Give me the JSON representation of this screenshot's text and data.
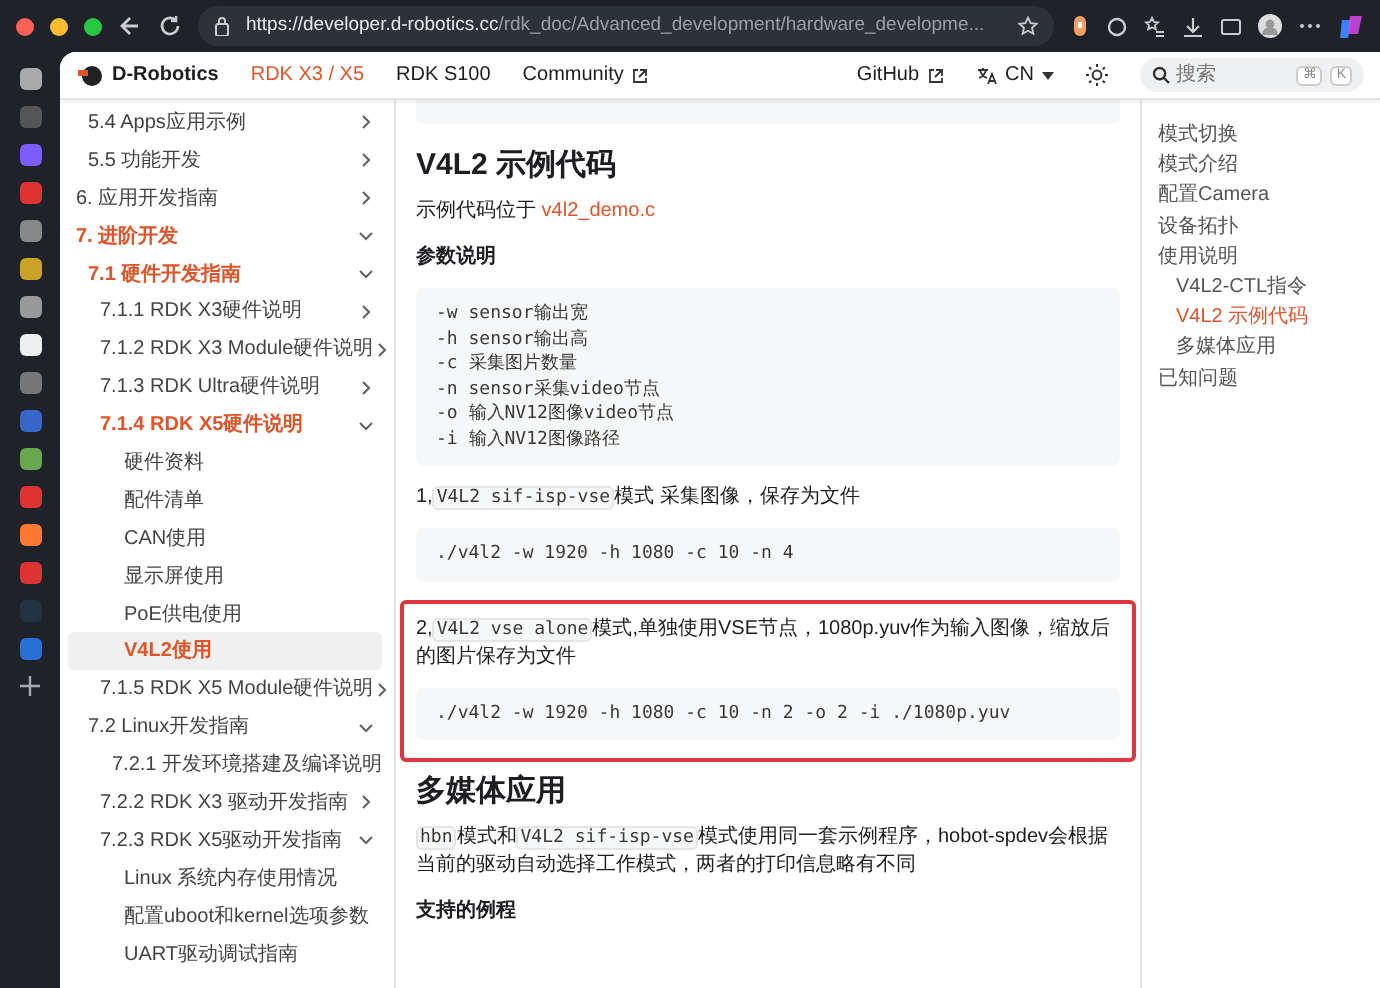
{
  "browser": {
    "url_host": "https://developer.d-robotics.cc",
    "url_path": "/rdk_doc/Advanced_development/hardware_developme..."
  },
  "navbar": {
    "brand": "D-Robotics",
    "links": [
      {
        "label": "RDK X3 / X5",
        "selected": true,
        "external": false
      },
      {
        "label": "RDK S100",
        "selected": false,
        "external": false
      },
      {
        "label": "Community",
        "selected": false,
        "external": true
      }
    ],
    "github": "GitHub",
    "language": "CN",
    "search": {
      "placeholder": "搜索",
      "keys": [
        "⌘",
        "K"
      ]
    }
  },
  "sidebar": {
    "items": [
      {
        "children": [
          {
            "label": "5.4 Apps应用示例",
            "kind": "category",
            "expanded": false,
            "active": false,
            "selected": false
          },
          {
            "label": "5.5 功能开发",
            "kind": "category",
            "expanded": false,
            "active": false,
            "selected": false
          }
        ]
      },
      {
        "label": "6. 应用开发指南",
        "kind": "category",
        "expanded": false,
        "active": false,
        "selected": false
      },
      {
        "label": "7. 进阶开发",
        "kind": "category",
        "expanded": true,
        "active": true,
        "selected": false,
        "children": [
          {
            "label": "7.1 硬件开发指南",
            "kind": "category",
            "expanded": true,
            "active": true,
            "selected": false,
            "children": [
              {
                "label": "7.1.1 RDK X3硬件说明",
                "kind": "category",
                "expanded": false,
                "active": false,
                "selected": false
              },
              {
                "label": "7.1.2 RDK X3 Module硬件说明",
                "kind": "category",
                "expanded": false,
                "active": false,
                "selected": false
              },
              {
                "label": "7.1.3 RDK Ultra硬件说明",
                "kind": "category",
                "expanded": false,
                "active": false,
                "selected": false
              },
              {
                "label": "7.1.4 RDK X5硬件说明",
                "kind": "category",
                "expanded": true,
                "active": true,
                "selected": false,
                "children": [
                  {
                    "label": "硬件资料",
                    "kind": "link",
                    "active": false,
                    "selected": false
                  },
                  {
                    "label": "配件清单",
                    "kind": "link",
                    "active": false,
                    "selected": false
                  },
                  {
                    "label": "CAN使用",
                    "kind": "link",
                    "active": false,
                    "selected": false
                  },
                  {
                    "label": "显示屏使用",
                    "kind": "link",
                    "active": false,
                    "selected": false
                  },
                  {
                    "label": "PoE供电使用",
                    "kind": "link",
                    "active": false,
                    "selected": false
                  },
                  {
                    "label": "V4L2使用",
                    "kind": "link",
                    "active": true,
                    "selected": true
                  }
                ]
              },
              {
                "label": "7.1.5 RDK X5 Module硬件说明",
                "kind": "category",
                "expanded": false,
                "active": false,
                "selected": false
              }
            ]
          },
          {
            "label": "7.2 Linux开发指南",
            "kind": "category",
            "expanded": true,
            "active": false,
            "selected": false,
            "children": [
              {
                "label": "7.2.1 开发环境搭建及编译说明",
                "kind": "link",
                "active": false,
                "selected": false
              },
              {
                "label": "7.2.2 RDK X3 驱动开发指南",
                "kind": "category",
                "expanded": false,
                "active": false,
                "selected": false
              },
              {
                "label": "7.2.3 RDK X5驱动开发指南",
                "kind": "category",
                "expanded": true,
                "active": false,
                "selected": false,
                "children": [
                  {
                    "label": "Linux 系统内存使用情况",
                    "kind": "link",
                    "active": false,
                    "selected": false
                  },
                  {
                    "label": "配置uboot和kernel选项参数",
                    "kind": "link",
                    "active": false,
                    "selected": false
                  },
                  {
                    "label": "UART驱动调试指南",
                    "kind": "link",
                    "active": false,
                    "selected": false
                  }
                ]
              }
            ]
          }
        ]
      }
    ]
  },
  "content": {
    "blocks": [
      {
        "kind": "code_tail"
      },
      {
        "kind": "heading",
        "text": "V4L2 示例代码"
      },
      {
        "kind": "paragraph",
        "parts": [
          {
            "kind": "text",
            "text": "示例代码位于 "
          },
          {
            "kind": "link",
            "text": "v4l2_demo.c"
          }
        ]
      },
      {
        "kind": "label",
        "text": "参数说明"
      },
      {
        "kind": "code",
        "lines": [
          "-w sensor输出宽",
          "-h sensor输出高",
          "-c 采集图片数量",
          "-n sensor采集video节点",
          "-o 输入NV12图像video节点",
          "-i 输入NV12图像路径"
        ]
      },
      {
        "kind": "paragraph",
        "parts": [
          {
            "kind": "text",
            "text": "1,"
          },
          {
            "kind": "code",
            "text": "V4L2 sif-isp-vse"
          },
          {
            "kind": "text",
            "text": "模式 采集图像，保存为文件"
          }
        ]
      },
      {
        "kind": "code",
        "lines": [
          "./v4l2 -w 1920 -h 1080 -c 10 -n 4"
        ]
      },
      {
        "kind": "highlight",
        "blocks": [
          {
            "kind": "paragraph",
            "parts": [
              {
                "kind": "text",
                "text": "2,"
              },
              {
                "kind": "code",
                "text": "V4L2 vse alone"
              },
              {
                "kind": "text",
                "text": "模式,单独使用VSE节点，1080p.yuv作为输入图像，缩放后的图片保存为文件"
              }
            ]
          },
          {
            "kind": "code",
            "lines": [
              "./v4l2 -w 1920 -h 1080 -c 10 -n 2 -o 2 -i ./1080p.yuv"
            ]
          }
        ]
      },
      {
        "kind": "heading",
        "text": "多媒体应用"
      },
      {
        "kind": "paragraph",
        "parts": [
          {
            "kind": "code",
            "text": "hbn"
          },
          {
            "kind": "text",
            "text": "模式和"
          },
          {
            "kind": "code",
            "text": "V4L2 sif-isp-vse"
          },
          {
            "kind": "text",
            "text": "模式使用同一套示例程序，hobot-spdev会根据当前的驱动自动选择工作模式，两者的打印信息略有不同"
          }
        ]
      },
      {
        "kind": "label",
        "text": "支持的例程"
      }
    ]
  },
  "toc": {
    "items": [
      {
        "label": "模式切换",
        "selected": false
      },
      {
        "label": "模式介绍",
        "selected": false
      },
      {
        "label": "配置Camera",
        "selected": false
      },
      {
        "label": "设备拓扑",
        "selected": false
      },
      {
        "label": "使用说明",
        "selected": false,
        "children": [
          {
            "label": "V4L2-CTL指令",
            "selected": false
          },
          {
            "label": "V4L2 示例代码",
            "selected": true
          },
          {
            "label": "多媒体应用",
            "selected": false
          }
        ]
      },
      {
        "label": "已知问题",
        "selected": false
      }
    ]
  }
}
